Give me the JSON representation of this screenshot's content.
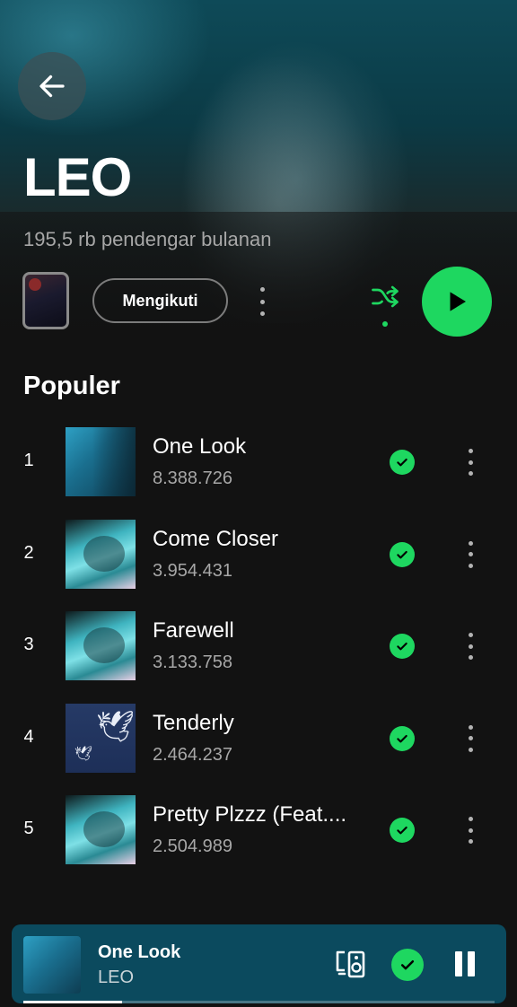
{
  "artist": {
    "name": "LEO",
    "monthly_listeners": "195,5 rb pendengar bulanan"
  },
  "controls": {
    "follow_label": "Mengikuti"
  },
  "popular": {
    "title": "Populer",
    "tracks": [
      {
        "rank": "1",
        "title": "One Look",
        "plays": "8.388.726",
        "art": "blue-portrait"
      },
      {
        "rank": "2",
        "title": "Come Closer",
        "plays": "3.954.431",
        "art": "cyan-portrait"
      },
      {
        "rank": "3",
        "title": "Farewell",
        "plays": "3.133.758",
        "art": "cyan-portrait"
      },
      {
        "rank": "4",
        "title": "Tenderly",
        "plays": "2.464.237",
        "art": "dove"
      },
      {
        "rank": "5",
        "title": "Pretty Plzzz (Feat....",
        "plays": "2.504.989",
        "art": "cyan-portrait"
      }
    ]
  },
  "now_playing": {
    "title": "One Look",
    "artist": "LEO",
    "progress": 0.21
  },
  "colors": {
    "accent": "#1ed760",
    "background": "#121212",
    "now_playing_bg": "#0b4a5e"
  },
  "icons": {
    "back": "arrow-left-icon",
    "shuffle": "shuffle-icon",
    "play": "play-icon",
    "downloaded": "check-circle-icon",
    "device": "device-speaker-icon",
    "pause": "pause-icon"
  }
}
